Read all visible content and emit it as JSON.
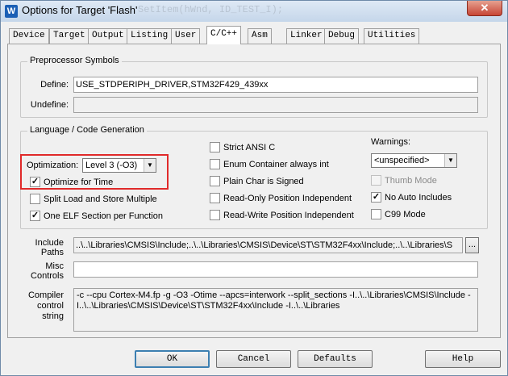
{
  "window": {
    "title": "Options for Target 'Flash'",
    "background_code": "    SetItem(hWnd, ID_TEST_I);",
    "close_label": "✕"
  },
  "tabs": [
    "Device",
    "Target",
    "Output",
    "Listing",
    "User",
    "C/C++",
    "Asm",
    "Linker",
    "Debug",
    "Utilities"
  ],
  "active_tab": "C/C++",
  "preprocessor": {
    "legend": "Preprocessor Symbols",
    "define_label": "Define:",
    "define_value": "USE_STDPERIPH_DRIVER,STM32F429_439xx",
    "undefine_label": "Undefine:",
    "undefine_value": ""
  },
  "language": {
    "legend": "Language / Code Generation",
    "optimization_label": "Optimization:",
    "optimization_value": "Level 3 (-O3)",
    "optimize_for_time": {
      "label": "Optimize for Time",
      "checked": true
    },
    "split_load_store": {
      "label": "Split Load and Store Multiple",
      "checked": false
    },
    "one_elf_section": {
      "label": "One ELF Section per Function",
      "checked": true
    },
    "strict_ansi": {
      "label": "Strict ANSI C",
      "checked": false
    },
    "enum_container": {
      "label": "Enum Container always int",
      "checked": false
    },
    "plain_char": {
      "label": "Plain Char is Signed",
      "checked": false
    },
    "ro_pi": {
      "label": "Read-Only Position Independent",
      "checked": false
    },
    "rw_pi": {
      "label": "Read-Write Position Independent",
      "checked": false
    },
    "warnings_label": "Warnings:",
    "warnings_value": "<unspecified>",
    "thumb_mode": {
      "label": "Thumb Mode",
      "checked": false,
      "disabled": true
    },
    "no_auto_includes": {
      "label": "No Auto Includes",
      "checked": true
    },
    "c99_mode": {
      "label": "C99 Mode",
      "checked": false
    }
  },
  "include_paths": {
    "label_line1": "Include",
    "label_line2": "Paths",
    "value": "..\\..\\Libraries\\CMSIS\\Include;..\\..\\Libraries\\CMSIS\\Device\\ST\\STM32F4xx\\Include;..\\..\\Libraries\\S",
    "browse_label": "..."
  },
  "misc_controls": {
    "label_line1": "Misc",
    "label_line2": "Controls",
    "value": ""
  },
  "compiler_string": {
    "label_line1": "Compiler",
    "label_line2": "control",
    "label_line3": "string",
    "line1": "-c --cpu Cortex-M4.fp -g -O3 -Otime --apcs=interwork --split_sections -I..\\..\\Libraries\\CMSIS\\Include -",
    "line2": "I..\\..\\Libraries\\CMSIS\\Device\\ST\\STM32F4xx\\Include -I..\\..\\Libraries"
  },
  "buttons": {
    "ok": "OK",
    "cancel": "Cancel",
    "defaults": "Defaults",
    "help": "Help"
  },
  "colors": {
    "highlight_box": "#e02a2a",
    "title_bar": "#c5d6ea",
    "close_button": "#c74535"
  }
}
